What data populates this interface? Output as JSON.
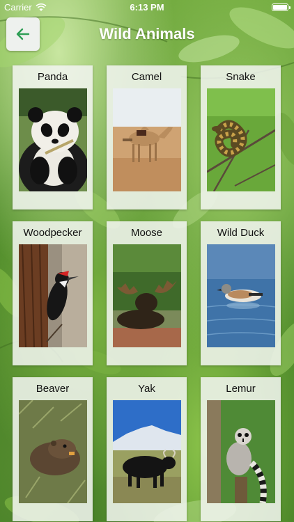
{
  "status_bar": {
    "carrier": "Carrier",
    "time": "6:13 PM"
  },
  "header": {
    "title": "Wild Animals",
    "back_icon": "arrow-left-icon"
  },
  "animals": [
    {
      "label": "Panda",
      "photo": "panda"
    },
    {
      "label": "Camel",
      "photo": "camel"
    },
    {
      "label": "Snake",
      "photo": "snake"
    },
    {
      "label": "Woodpecker",
      "photo": "woodpecker"
    },
    {
      "label": "Moose",
      "photo": "moose"
    },
    {
      "label": "Wild Duck",
      "photo": "wild-duck"
    },
    {
      "label": "Beaver",
      "photo": "beaver"
    },
    {
      "label": "Yak",
      "photo": "yak"
    },
    {
      "label": "Lemur",
      "photo": "lemur"
    }
  ],
  "colors": {
    "accent": "#2e9e55",
    "card": "#f0f4ee",
    "title": "#ffffff"
  }
}
